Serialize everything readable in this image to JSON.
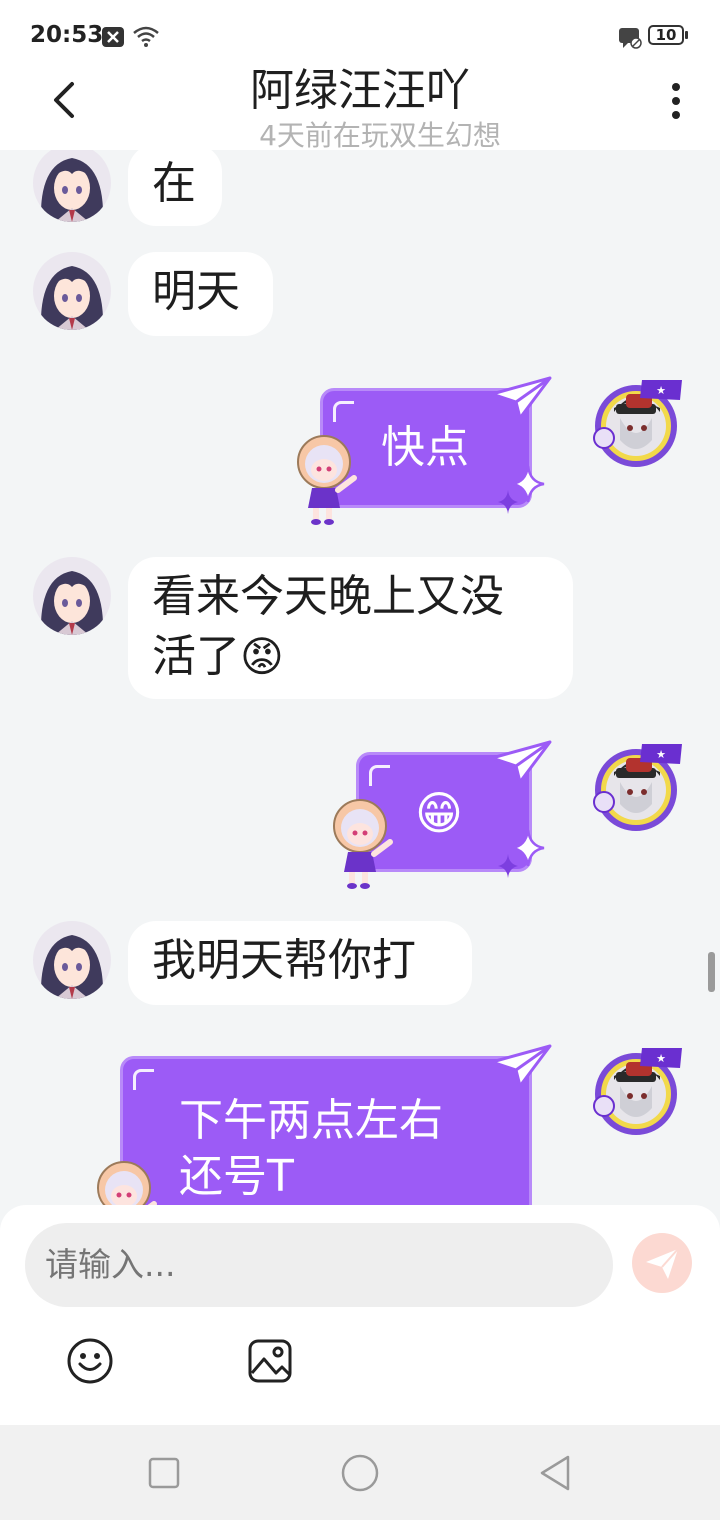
{
  "status_bar": {
    "time": "20:53",
    "battery": "10"
  },
  "header": {
    "title": "阿绿汪汪吖",
    "subtitle": "4天前在玩双生幻想"
  },
  "messages": [
    {
      "side": "left",
      "text": "在"
    },
    {
      "side": "left",
      "text": "明天"
    },
    {
      "side": "right",
      "text": "快点"
    },
    {
      "side": "left",
      "line1": "看来今天晚上又没",
      "line2": "活了",
      "emoji": "😡"
    },
    {
      "side": "right",
      "emoji": "😁"
    },
    {
      "side": "left",
      "text": "我明天帮你打"
    },
    {
      "side": "right",
      "line1": "下午两点左右",
      "line2": "还号T"
    }
  ],
  "input": {
    "placeholder": "请输入..."
  },
  "icons": {
    "back": "back-arrow-icon",
    "more": "more-vertical-icon",
    "send": "send-icon",
    "emoji": "emoji-icon",
    "image": "image-icon",
    "nav": [
      "recent-apps-icon",
      "home-icon",
      "back-icon"
    ]
  },
  "colors": {
    "bubble_right": "#9c5bf6",
    "bubble_left": "#ffffff",
    "chat_bg": "#f3f5f6",
    "send_button": "#fcd9d2"
  }
}
